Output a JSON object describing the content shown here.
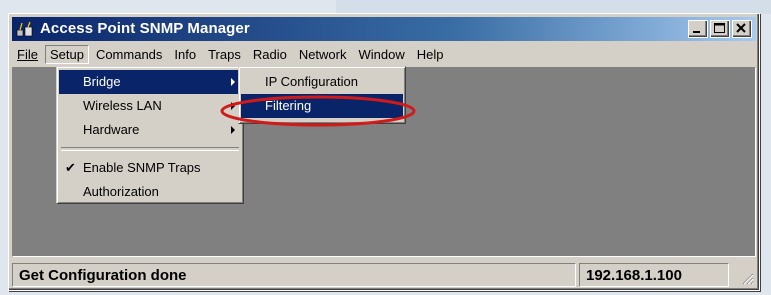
{
  "window": {
    "title": "Access Point SNMP Manager",
    "buttons": {
      "minimize": "minimize",
      "maximize": "maximize",
      "close": "close"
    }
  },
  "menubar": {
    "items": [
      {
        "label": "File"
      },
      {
        "label": "Setup"
      },
      {
        "label": "Commands"
      },
      {
        "label": "Info"
      },
      {
        "label": "Traps"
      },
      {
        "label": "Radio"
      },
      {
        "label": "Network"
      },
      {
        "label": "Window"
      },
      {
        "label": "Help"
      }
    ]
  },
  "setup_menu": {
    "items": [
      {
        "label": "Bridge",
        "submenu": true,
        "highlighted": true
      },
      {
        "label": "Wireless LAN",
        "submenu": true
      },
      {
        "label": "Hardware",
        "submenu": true
      },
      {
        "label": "Enable SNMP Traps",
        "checked": true
      },
      {
        "label": "Authorization"
      }
    ]
  },
  "bridge_submenu": {
    "items": [
      {
        "label": "IP Configuration"
      },
      {
        "label": "Filtering",
        "highlighted": true
      }
    ]
  },
  "statusbar": {
    "message": "Get Configuration done",
    "address": "192.168.1.100"
  },
  "colors": {
    "title_gradient_start": "#0a246a",
    "highlight": "#0a246a",
    "client_area": "#808080",
    "annotation": "#d11a1a"
  },
  "icons": [
    "app-icon",
    "minimize-icon",
    "maximize-icon",
    "close-icon",
    "submenu-arrow-icon",
    "checkmark-icon",
    "resize-grip-icon"
  ]
}
